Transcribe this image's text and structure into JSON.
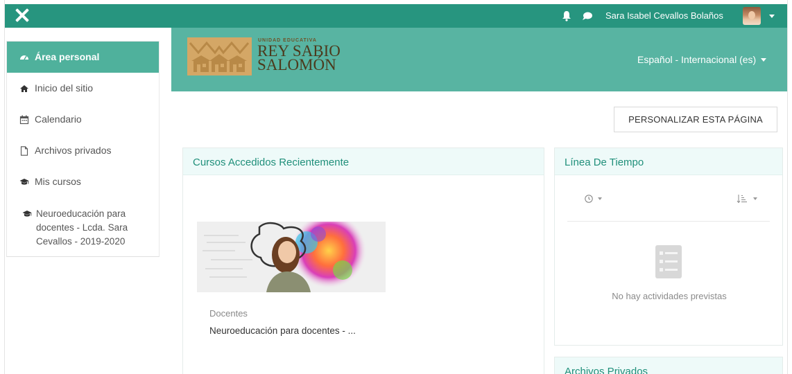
{
  "navbar": {
    "close_icon": "close-icon",
    "notifications_icon": "bell-icon",
    "messages_icon": "chat-bubble-icon",
    "user_name": "Sara Isabel Cevallos Bolaños",
    "avatar": "user-avatar"
  },
  "sidebar": {
    "items": [
      {
        "label": "Área personal",
        "icon": "dashboard-icon",
        "active": true
      },
      {
        "label": "Inicio del sitio",
        "icon": "home-icon"
      },
      {
        "label": "Calendario",
        "icon": "calendar-icon"
      },
      {
        "label": "Archivos privados",
        "icon": "file-icon"
      },
      {
        "label": "Mis cursos",
        "icon": "graduation-cap-icon"
      },
      {
        "label": "Neuroeducación para docentes - Lcda. Sara Cevallos - 2019-2020",
        "icon": "graduation-cap-icon"
      }
    ]
  },
  "header": {
    "logo_small": "UNIDAD EDUCATIVA",
    "logo_line1": "REY SABIO",
    "logo_line2": "SALOMÓN",
    "language": "Español - Internacional (es)"
  },
  "main": {
    "customize_button": "PERSONALIZAR ESTA PÁGINA",
    "recent": {
      "title": "Cursos Accedidos Recientemente",
      "course_category": "Docentes",
      "course_name": "Neuroeducación para docentes - ..."
    },
    "timeline": {
      "title": "Línea De Tiempo",
      "empty_text": "No hay actividades previstas",
      "filter_icon": "clock-icon",
      "sort_icon": "sort-icon"
    },
    "files": {
      "title": "Archivos Privados"
    }
  },
  "colors": {
    "navbar": "#27957f",
    "header": "#58b4a2",
    "sidebar_active": "#4fb19c",
    "card_header": "#eefaf9",
    "accent_text": "#1f8f7a",
    "logo_gold": "#d4a766"
  }
}
